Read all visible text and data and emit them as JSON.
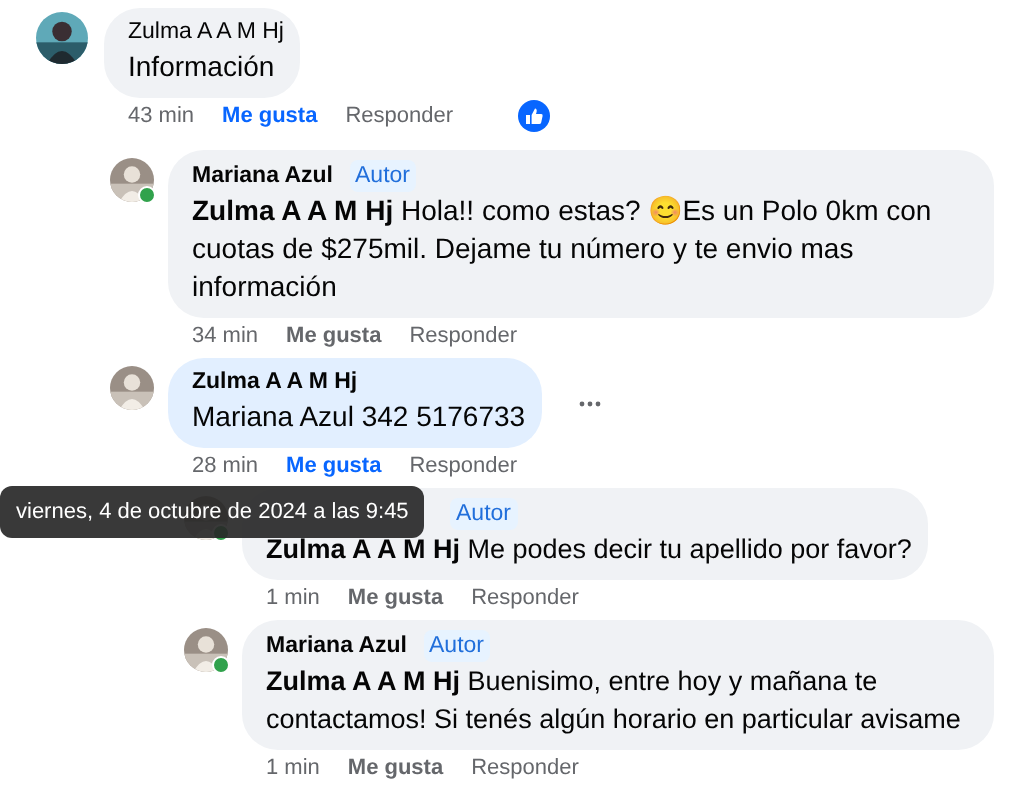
{
  "comments": [
    {
      "author": "Zulma A A M Hj",
      "body": "Información",
      "time": "43 min",
      "like_label": "Me gusta",
      "liked": true,
      "reply_label": "Responder",
      "reaction": true,
      "children": [
        {
          "author": "Mariana Azul",
          "badge": "Autor",
          "online": true,
          "body": "**Zulma A A M Hj** Hola!! como estas? 😊Es un Polo 0km con cuotas de $275mil. Dejame tu número y te envio mas información",
          "time": "34 min",
          "like_label": "Me gusta",
          "liked": false,
          "reply_label": "Responder"
        },
        {
          "author": "Zulma A A M Hj",
          "highlighted": true,
          "body": "Mariana Azul 342 5176733",
          "time": "28 min",
          "like_label": "Me gusta",
          "liked": true,
          "reply_label": "Responder",
          "more": true,
          "children": [
            {
              "badge": "Autor",
              "online": true,
              "body": "**Zulma A A M Hj** Me podes decir tu apellido por favor?",
              "time": "1 min",
              "like_label": "Me gusta",
              "liked": false,
              "reply_label": "Responder"
            },
            {
              "author": "Mariana Azul",
              "badge": "Autor",
              "online": true,
              "body": "**Zulma A A M Hj** Buenisimo, entre hoy y mañana te contactamos! Si tenés algún horario en particular avisame",
              "time": "1 min",
              "like_label": "Me gusta",
              "liked": false,
              "reply_label": "Responder"
            }
          ]
        }
      ]
    }
  ],
  "tooltip": {
    "text": "viernes, 4 de octubre de 2024 a las 9:45"
  }
}
